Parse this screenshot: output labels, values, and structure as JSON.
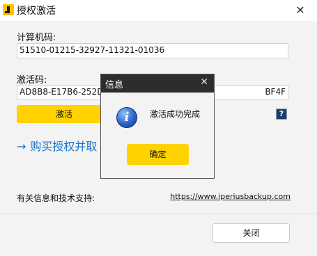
{
  "window": {
    "title": "授权激活",
    "icon": "app-logo-icon",
    "close_glyph": "✕"
  },
  "form": {
    "computer_code_label": "计算机码:",
    "computer_code_value": "51510-01215-32927-11321-01036",
    "activation_code_label": "激活码:",
    "activation_code_value": "AD8B8-E17B6-252D1-BF4F",
    "activation_code_visible_left": "AD8B8-E17B6-252D1",
    "activation_code_visible_right": "BF4F"
  },
  "buttons": {
    "activate": "激活",
    "help": "?",
    "close": "关闭"
  },
  "buy_link": {
    "arrow": "→",
    "text": "购买授权并取"
  },
  "support": {
    "label": "有关信息和技术支持:",
    "url": "https://www.iperiusbackup.com"
  },
  "dialog": {
    "title": "信息",
    "close_glyph": "✕",
    "message": "激活成功完成",
    "ok": "确定",
    "icon": "info-icon"
  },
  "colors": {
    "accent": "#ffd200",
    "link": "#1a73c8",
    "dialog_title_bg": "#2d2d2d"
  }
}
